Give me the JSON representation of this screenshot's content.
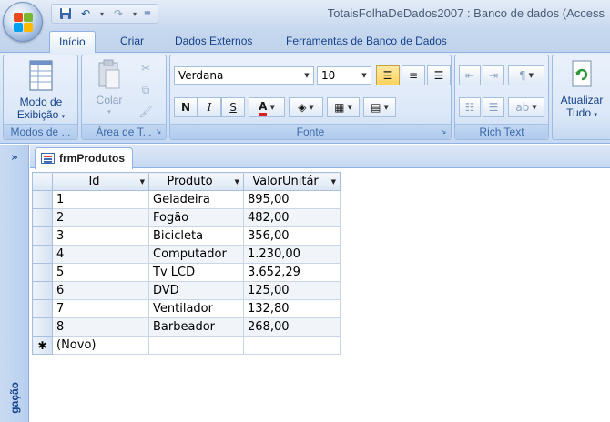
{
  "window": {
    "title": "TotaisFolhaDeDados2007 : Banco de dados (Access"
  },
  "quick_access": {
    "save": "save-icon",
    "undo": "undo-icon",
    "redo": "redo-icon",
    "customize": "customize-icon"
  },
  "tabs": [
    {
      "label": "Início",
      "active": true
    },
    {
      "label": "Criar",
      "active": false
    },
    {
      "label": "Dados Externos",
      "active": false
    },
    {
      "label": "Ferramentas de Banco de Dados",
      "active": false
    }
  ],
  "ribbon": {
    "views": {
      "group_label": "Modos de ...",
      "view_line1": "Modo de",
      "view_line2": "Exibição"
    },
    "clipboard": {
      "group_label": "Área de T...",
      "paste_label": "Colar"
    },
    "font": {
      "group_label": "Fonte",
      "font_name": "Verdana",
      "font_size": "10",
      "bold": "N",
      "italic": "I",
      "underline": "S",
      "font_color_letter": "A",
      "font_color": "#e02020"
    },
    "rich_text": {
      "group_label": "Rich Text"
    },
    "records": {
      "refresh_line1": "Atualizar",
      "refresh_line2": "Tudo"
    }
  },
  "nav_pane": {
    "toggle": "»",
    "label": "gação"
  },
  "document": {
    "tab_title": "frmProdutos",
    "columns": [
      "Id",
      "Produto",
      "ValorUnitár"
    ],
    "rows": [
      {
        "id": "1",
        "produto": "Geladeira",
        "valor": "895,00"
      },
      {
        "id": "2",
        "produto": "Fogão",
        "valor": "482,00"
      },
      {
        "id": "3",
        "produto": "Bicicleta",
        "valor": "356,00"
      },
      {
        "id": "4",
        "produto": "Computador",
        "valor": "1.230,00"
      },
      {
        "id": "5",
        "produto": "Tv LCD",
        "valor": "3.652,29"
      },
      {
        "id": "6",
        "produto": "DVD",
        "valor": "125,00"
      },
      {
        "id": "7",
        "produto": "Ventilador",
        "valor": "132,80"
      },
      {
        "id": "8",
        "produto": "Barbeador",
        "valor": "268,00"
      }
    ],
    "new_record_marker": "✱",
    "new_record_label": "(Novo)"
  }
}
